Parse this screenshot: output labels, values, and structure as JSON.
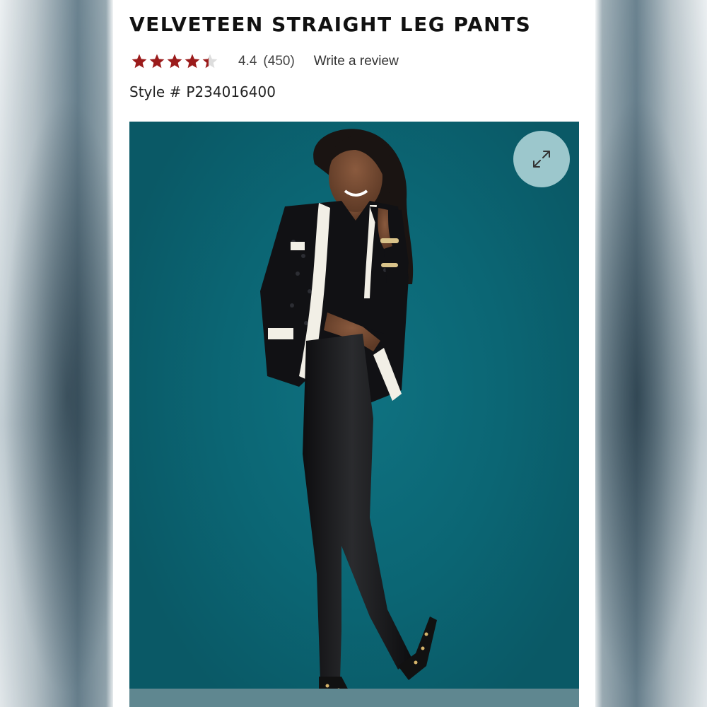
{
  "product": {
    "title": "VELVETEEN STRAIGHT LEG PANTS",
    "rating": {
      "value": "4.4",
      "count": "(450)",
      "stars_filled": 4.4,
      "stars_total": 5,
      "star_color": "#9b1b1b",
      "star_empty_color": "#dddddd"
    },
    "write_review_label": "Write a review",
    "style_prefix": "Style #",
    "style_number": "P234016400"
  },
  "image_viewer": {
    "expand_icon": "expand-arrows-icon",
    "background_color": "#0b6674"
  }
}
